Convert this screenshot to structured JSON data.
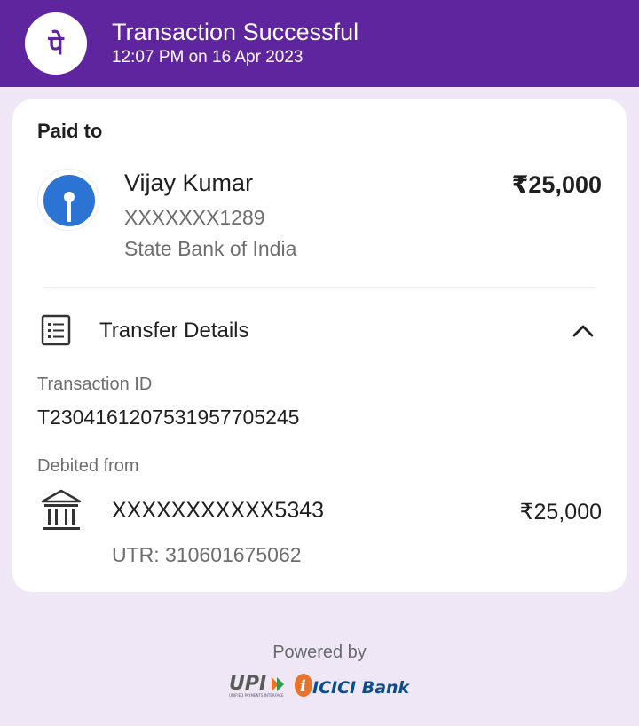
{
  "header": {
    "title": "Transaction Successful",
    "datetime": "12:07 PM on 16 Apr 2023",
    "logo_icon": "phonepe-logo-icon",
    "logo_glyph": "पे"
  },
  "paid_to": {
    "heading": "Paid to",
    "name": "Vijay Kumar",
    "account": "XXXXXXX1289",
    "bank": "State Bank of India",
    "amount": "₹25,000",
    "bank_logo_icon": "sbi-logo-icon"
  },
  "transfer_details": {
    "label": "Transfer Details",
    "icon": "receipt-list-icon",
    "toggle_icon": "chevron-up-icon"
  },
  "transaction": {
    "id_label": "Transaction ID",
    "id_value": "T2304161207531957705245"
  },
  "debited_from": {
    "label": "Debited from",
    "account": "XXXXXXXXXXX5343",
    "amount": "₹25,000",
    "utr": "UTR: 310601675062",
    "icon": "bank-building-icon"
  },
  "footer": {
    "powered_by": "Powered by",
    "upi_logo": "UPI",
    "upi_tagline": "UNIFIED PAYMENTS INTERFACE",
    "icici_logo": "ICICI Bank"
  },
  "colors": {
    "brand_purple": "#5f259f",
    "page_background": "#efe7f6",
    "sbi_blue": "#2b74d4",
    "icici_orange": "#e8732a",
    "icici_blue": "#0b4f8a"
  }
}
